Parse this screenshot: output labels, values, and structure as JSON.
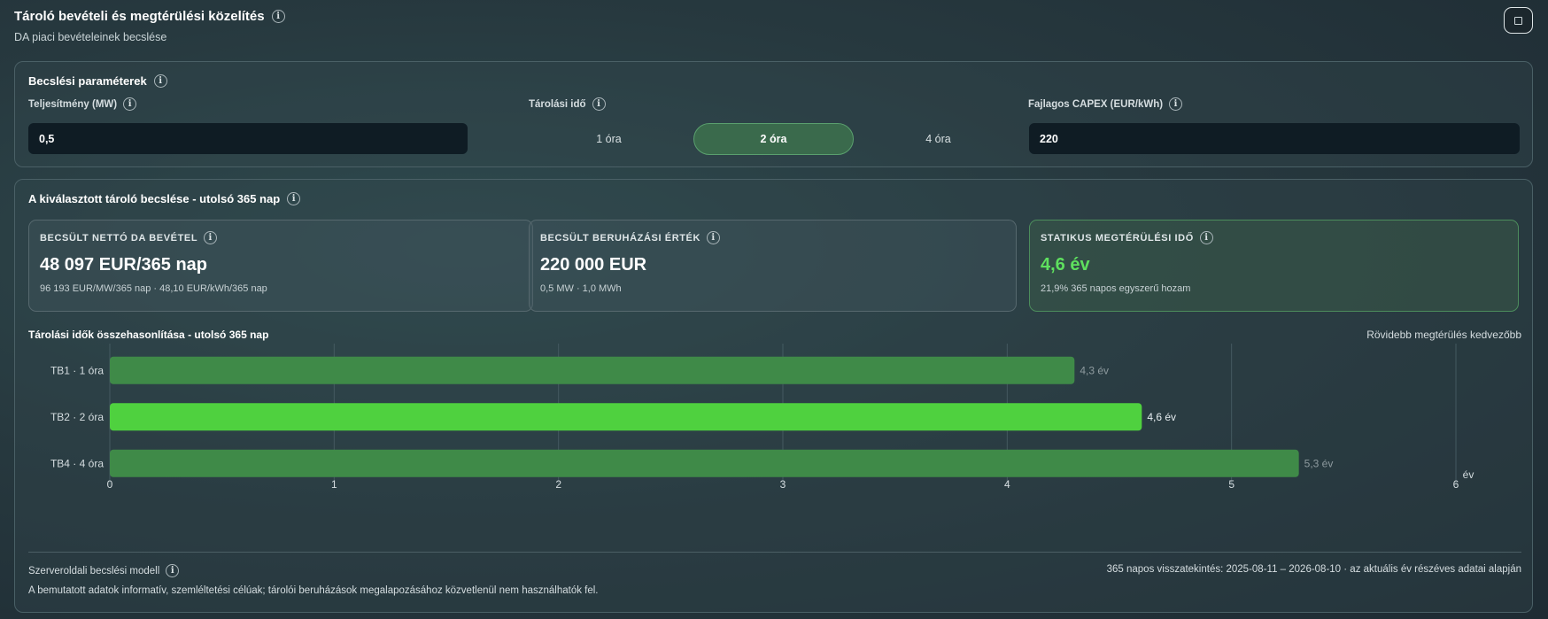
{
  "header": {
    "title": "Tároló bevételi és megtérülési közelítés",
    "subtitle": "DA piaci bevételeinek becslése"
  },
  "params": {
    "title": "Becslési paraméterek",
    "power_label": "Teljesítmény (MW)",
    "power_value": "0,5",
    "storage_label": "Tárolási idő",
    "storage_options": [
      "1 óra",
      "2 óra",
      "4 óra"
    ],
    "storage_selected": "2 óra",
    "capex_label": "Fajlagos CAPEX (EUR/kWh)",
    "capex_value": "220"
  },
  "estimate": {
    "title": "A kiválasztott tároló becslése - utolsó 365 nap",
    "cards": [
      {
        "label": "BECSÜLT NETTÓ DA BEVÉTEL",
        "value": "48 097 EUR/365 nap",
        "sub": "96 193 EUR/MW/365 nap · 48,10 EUR/kWh/365 nap"
      },
      {
        "label": "BECSÜLT BERUHÁZÁSI ÉRTÉK",
        "value": "220 000 EUR",
        "sub": "0,5 MW · 1,0 MWh"
      },
      {
        "label": "STATIKUS MEGTÉRÜLÉSI IDŐ",
        "value": "4,6 év",
        "sub": "21,9% 365 napos egyszerű hozam"
      }
    ],
    "chart_title": "Tárolási idők összehasonlítása - utolsó 365 nap",
    "chart_note": "Rövidebb megtérülés kedvezőbb",
    "model_label": "Szerveroldali becslési modell",
    "period": "365 napos visszatekintés: 2025-08-11 – 2026-08-10 · az aktuális év részéves adatai alapján",
    "disclaimer": "A bemutatott adatok informatív, szemléltetési célúak; tárolói beruházások megalapozásához közvetlenül nem használhatók fel."
  },
  "colors": {
    "bar": "#3f8a48",
    "bar_selected": "#4fd13f",
    "accent_green": "#5ee05e"
  },
  "chart_data": {
    "type": "bar",
    "orientation": "horizontal",
    "categories": [
      "TB1 · 1 óra",
      "TB2 · 2 óra",
      "TB4 · 4 óra"
    ],
    "values": [
      4.3,
      4.6,
      5.3
    ],
    "value_labels": [
      "4,3 év",
      "4,6 év",
      "5,3 év"
    ],
    "selected_index": 1,
    "xlabel": "év",
    "xlim": [
      0,
      6
    ],
    "xticks": [
      0,
      1,
      2,
      3,
      4,
      5,
      6
    ],
    "grid": true
  }
}
